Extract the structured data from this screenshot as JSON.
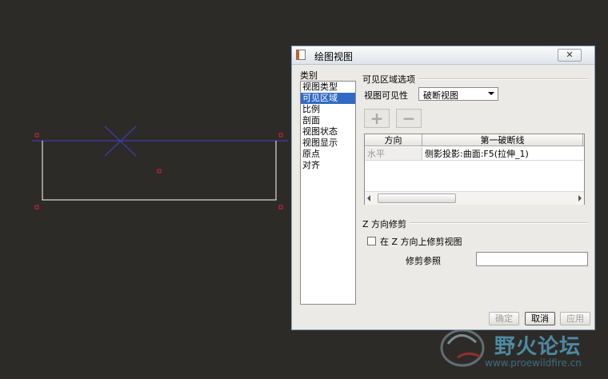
{
  "dialog": {
    "title": "绘图视图",
    "close_label": "✕",
    "category_label": "类别",
    "categories": [
      "视图类型",
      "可见区域",
      "比例",
      "剖面",
      "视图状态",
      "视图显示",
      "原点",
      "对齐"
    ],
    "selected_category": "可见区域",
    "visible_area_group": "可见区域选项",
    "visibility_label": "视图可见性",
    "visibility_value": "破断视图",
    "add_label": "+",
    "remove_label": "−",
    "table": {
      "headers": [
        "方向",
        "第一破断线"
      ],
      "rows": [
        [
          "水平",
          "侧影投影:曲面:F5(拉伸_1)"
        ]
      ]
    },
    "z_trim_group": "Z 方向修剪",
    "z_trim_checkbox_label": "在 Z 方向上修剪视图",
    "z_trim_checked": false,
    "trim_ref_label": "修剪参照",
    "trim_ref_value": "",
    "buttons": {
      "ok": "确定",
      "cancel": "取消",
      "apply": "应用"
    }
  },
  "watermark": {
    "text": "野火论坛",
    "url": "www.proewildfire.cn"
  },
  "colors": {
    "background": "#2d2b28",
    "selection": "#316ac5",
    "drawing_line": "#4040c8",
    "point_marker": "#d02040"
  }
}
